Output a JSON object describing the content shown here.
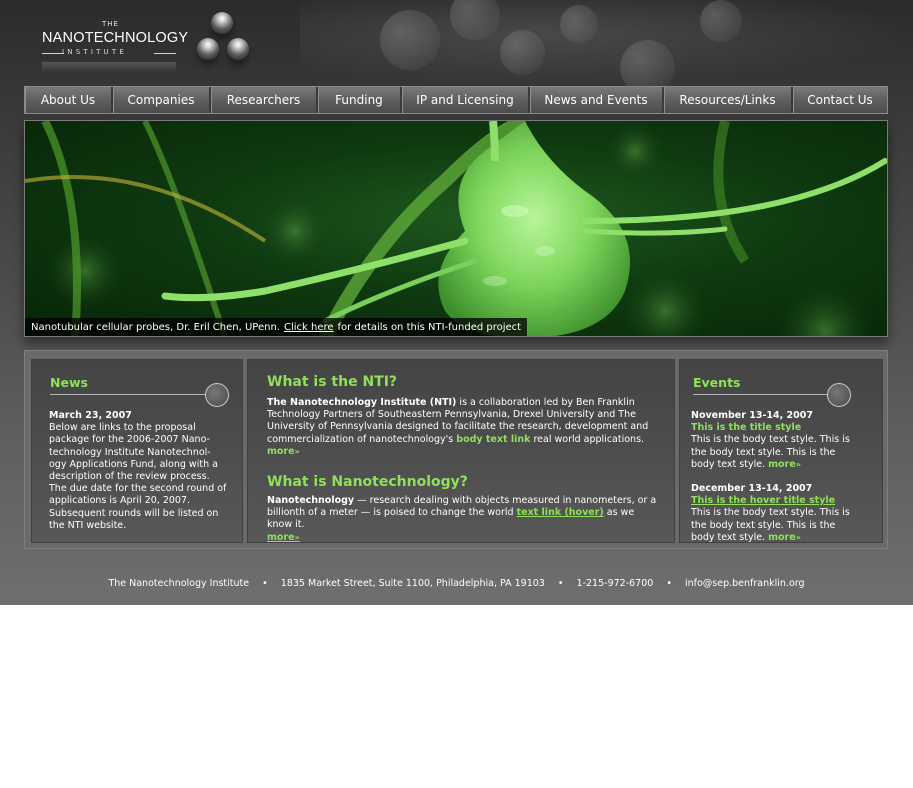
{
  "logo": {
    "the": "THE",
    "name": "NANOTECHNOLOGY",
    "institute": "INSTITUTE"
  },
  "nav": {
    "items": [
      {
        "label": "About Us"
      },
      {
        "label": "Companies"
      },
      {
        "label": "Researchers"
      },
      {
        "label": "Funding"
      },
      {
        "label": "IP and Licensing"
      },
      {
        "label": "News and Events"
      },
      {
        "label": "Resources/Links"
      },
      {
        "label": "Contact Us"
      }
    ]
  },
  "banner": {
    "caption_text": "Nanotubular cellular probes, Dr. Eril Chen, UPenn.",
    "caption_link": "Click here",
    "caption_suffix": "for details on this NTI-funded project"
  },
  "news": {
    "title": "News",
    "date": "March 23, 2007",
    "body": "Below are links to the proposal package for the 2006-2007 Nano-technology Institute Nanotechnol-ogy Applications Fund, along with a description of the review process. The due date for the second round of applications is April 20, 2007. Subsequent rounds will be listed on the NTI website."
  },
  "main": {
    "section1": {
      "heading": "What is the NTI?",
      "bold_lead": "The Nanotechnology Institute (NTI)",
      "text_a": " is a collaboration led by Ben Franklin Technology Partners of Southeastern Pennsylvania, Drexel University and The University of Pennsylvania designed to facilitate the research, development and commercialization of nanotechnology's ",
      "link": "body text link",
      "text_b": " real world applications.",
      "more": "more"
    },
    "section2": {
      "heading": "What is Nanotechnology?",
      "bold_lead": "Nanotechnology",
      "text_a": " — research dealing with objects measured in nanometers, or a billionth of a meter — is poised to change the world ",
      "link": "text link (hover)",
      "text_b": " as we know it.",
      "more": "more"
    }
  },
  "events": {
    "title": "Events",
    "items": [
      {
        "date": "November 13-14, 2007",
        "title": "This is the title style",
        "body": "This is the body text style. This is the body text style. This is the body text style.",
        "more": "more"
      },
      {
        "date": "December 13-14, 2007",
        "title": "This is the hover title style",
        "body": "This is the body text style. This is the body text style. This is the body text style.",
        "more": "more"
      }
    ]
  },
  "footer": {
    "org": "The Nanotechnology Institute",
    "address": "1835 Market Street, Suite 1100, Philadelphia, PA 19103",
    "phone": "1-215-972-6700",
    "email": "info@sep.benfranklin.org",
    "separator": "•"
  },
  "colors": {
    "accent_green": "#8fe05a",
    "background_dark": "#2b2b2b",
    "panel": "#4b4b4b"
  },
  "icons": {
    "more_arrow": "double-chevron-right-icon",
    "panel_knob": "circle-knob-icon"
  }
}
